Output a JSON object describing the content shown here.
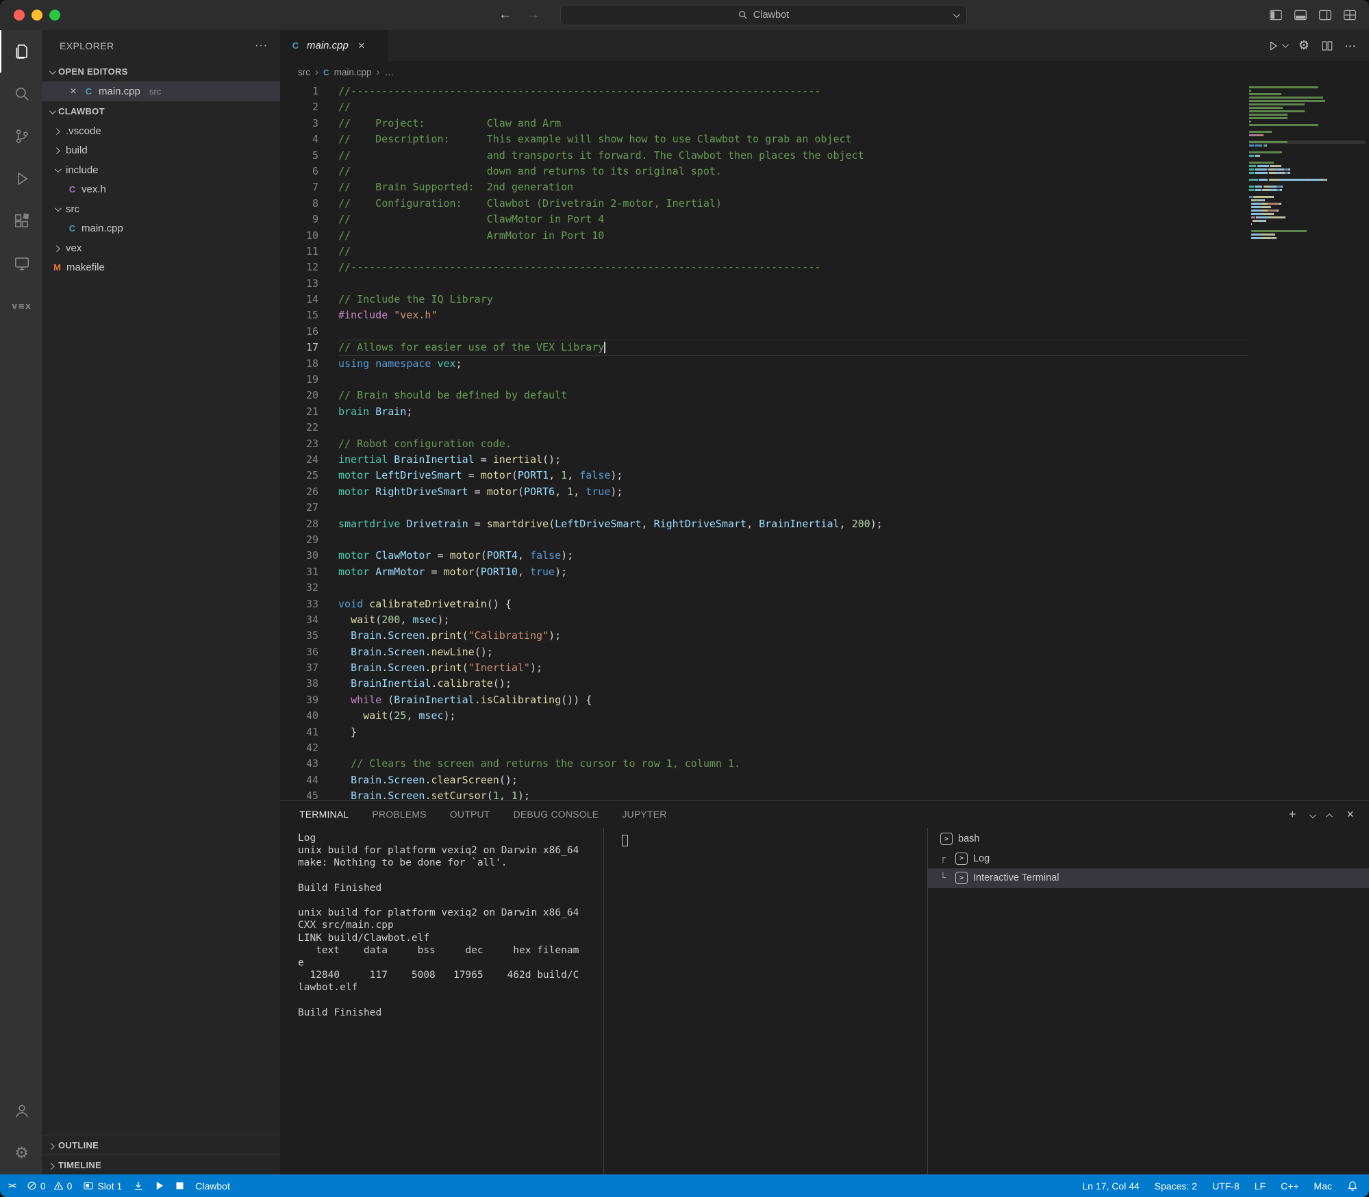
{
  "colors": {
    "accent": "#007acc",
    "titlebar-bg": "#2d2d2d",
    "activity-bg": "#333333",
    "sidebar-bg": "#252526",
    "editor-bg": "#1e1e1e",
    "selection-bg": "#37373d",
    "panel-border": "#414141",
    "tab-strip-bg": "#252526",
    "tok-comment": "#6a9955",
    "tok-keyword": "#569cd6",
    "tok-control": "#c586c0",
    "tok-type": "#4ec9b0",
    "tok-func": "#dcdcaa",
    "tok-string": "#ce9178",
    "tok-number": "#b5cea8",
    "tok-var": "#9cdcfe",
    "tok-plain": "#d4d4d4",
    "traffic-red": "#ff5f57",
    "traffic-yellow": "#febc2e",
    "traffic-green": "#28c840"
  },
  "icons": {
    "cpp": {
      "glyph": "C",
      "color": "#519aba"
    },
    "c-header": {
      "glyph": "C",
      "color": "#a074c4"
    },
    "makefile": {
      "glyph": "M",
      "color": "#e37933"
    },
    "gear": {
      "glyph": "⚙"
    },
    "more": {
      "glyph": "···"
    },
    "plus": {
      "glyph": "+"
    },
    "close": {
      "glyph": "×"
    },
    "back": {
      "glyph": "←"
    },
    "forward": {
      "glyph": "→"
    },
    "breadcrumb-sep": {
      "glyph": "›"
    },
    "remote": {
      "glyph": "><"
    },
    "vex-logo": {
      "glyph": "v≡x"
    },
    "term-prompt": {
      "glyph": ">"
    }
  },
  "titlebar": {
    "search_value": "Clawbot"
  },
  "sidebar": {
    "title": "EXPLORER",
    "open_editors": {
      "label": "OPEN EDITORS",
      "file": "main.cpp",
      "detail": "src"
    },
    "project": {
      "label": "CLAWBOT",
      "items": [
        {
          "label": ".vscode",
          "kind": "folder",
          "expanded": false,
          "indent": 1
        },
        {
          "label": "build",
          "kind": "folder",
          "expanded": false,
          "indent": 1
        },
        {
          "label": "include",
          "kind": "folder",
          "expanded": true,
          "indent": 1
        },
        {
          "label": "vex.h",
          "kind": "file",
          "icon": "c-header",
          "indent": 2
        },
        {
          "label": "src",
          "kind": "folder",
          "expanded": true,
          "indent": 1
        },
        {
          "label": "main.cpp",
          "kind": "file",
          "icon": "cpp",
          "indent": 2
        },
        {
          "label": "vex",
          "kind": "folder",
          "expanded": false,
          "indent": 1
        },
        {
          "label": "makefile",
          "kind": "file",
          "icon": "makefile",
          "indent": 1
        }
      ]
    },
    "outline_label": "OUTLINE",
    "timeline_label": "TIMELINE"
  },
  "editor": {
    "tab": {
      "label": "main.cpp"
    },
    "breadcrumb": [
      "src",
      "main.cpp",
      "…"
    ],
    "cursor": {
      "line": 17,
      "col": 44
    },
    "lines": [
      {
        "n": 1,
        "s": [
          [
            "cm",
            "//----------------------------------------------------------------------------"
          ]
        ]
      },
      {
        "n": 2,
        "s": [
          [
            "cm",
            "//"
          ]
        ]
      },
      {
        "n": 3,
        "s": [
          [
            "cm",
            "//    Project:          Claw and Arm"
          ]
        ]
      },
      {
        "n": 4,
        "s": [
          [
            "cm",
            "//    Description:      This example will show how to use Clawbot to grab an object"
          ]
        ]
      },
      {
        "n": 5,
        "s": [
          [
            "cm",
            "//                      and transports it forward. The Clawbot then places the object"
          ]
        ]
      },
      {
        "n": 6,
        "s": [
          [
            "cm",
            "//                      down and returns to its original spot."
          ]
        ]
      },
      {
        "n": 7,
        "s": [
          [
            "cm",
            "//    Brain Supported:  2nd generation"
          ]
        ]
      },
      {
        "n": 8,
        "s": [
          [
            "cm",
            "//    Configuration:    Clawbot (Drivetrain 2-motor, Inertial)"
          ]
        ]
      },
      {
        "n": 9,
        "s": [
          [
            "cm",
            "//                      ClawMotor in Port 4"
          ]
        ]
      },
      {
        "n": 10,
        "s": [
          [
            "cm",
            "//                      ArmMotor in Port 10"
          ]
        ]
      },
      {
        "n": 11,
        "s": [
          [
            "cm",
            "//"
          ]
        ]
      },
      {
        "n": 12,
        "s": [
          [
            "cm",
            "//----------------------------------------------------------------------------"
          ]
        ]
      },
      {
        "n": 13,
        "s": []
      },
      {
        "n": 14,
        "s": [
          [
            "cm",
            "// Include the IQ Library"
          ]
        ]
      },
      {
        "n": 15,
        "s": [
          [
            "ctl",
            "#include "
          ],
          [
            "st",
            "\"vex.h\""
          ]
        ]
      },
      {
        "n": 16,
        "s": []
      },
      {
        "n": 17,
        "s": [
          [
            "cm",
            "// Allows for easier use of the VEX Library"
          ]
        ]
      },
      {
        "n": 18,
        "s": [
          [
            "kw",
            "using"
          ],
          [
            "pl",
            " "
          ],
          [
            "kw",
            "namespace"
          ],
          [
            "pl",
            " "
          ],
          [
            "ty",
            "vex"
          ],
          [
            "pl",
            ";"
          ]
        ]
      },
      {
        "n": 19,
        "s": []
      },
      {
        "n": 20,
        "s": [
          [
            "cm",
            "// Brain should be defined by default"
          ]
        ]
      },
      {
        "n": 21,
        "s": [
          [
            "ty",
            "brain"
          ],
          [
            "pl",
            " "
          ],
          [
            "vr",
            "Brain"
          ],
          [
            "pl",
            ";"
          ]
        ]
      },
      {
        "n": 22,
        "s": []
      },
      {
        "n": 23,
        "s": [
          [
            "cm",
            "// Robot configuration code."
          ]
        ]
      },
      {
        "n": 24,
        "s": [
          [
            "ty",
            "inertial"
          ],
          [
            "pl",
            " "
          ],
          [
            "vr",
            "BrainInertial"
          ],
          [
            "pl",
            " = "
          ],
          [
            "fn",
            "inertial"
          ],
          [
            "pl",
            "();"
          ]
        ]
      },
      {
        "n": 25,
        "s": [
          [
            "ty",
            "motor"
          ],
          [
            "pl",
            " "
          ],
          [
            "vr",
            "LeftDriveSmart"
          ],
          [
            "pl",
            " = "
          ],
          [
            "fn",
            "motor"
          ],
          [
            "pl",
            "("
          ],
          [
            "vr",
            "PORT1"
          ],
          [
            "pl",
            ", "
          ],
          [
            "nu",
            "1"
          ],
          [
            "pl",
            ", "
          ],
          [
            "kw",
            "false"
          ],
          [
            "pl",
            ");"
          ]
        ]
      },
      {
        "n": 26,
        "s": [
          [
            "ty",
            "motor"
          ],
          [
            "pl",
            " "
          ],
          [
            "vr",
            "RightDriveSmart"
          ],
          [
            "pl",
            " = "
          ],
          [
            "fn",
            "motor"
          ],
          [
            "pl",
            "("
          ],
          [
            "vr",
            "PORT6"
          ],
          [
            "pl",
            ", "
          ],
          [
            "nu",
            "1"
          ],
          [
            "pl",
            ", "
          ],
          [
            "kw",
            "true"
          ],
          [
            "pl",
            ");"
          ]
        ]
      },
      {
        "n": 27,
        "s": []
      },
      {
        "n": 28,
        "s": [
          [
            "ty",
            "smartdrive"
          ],
          [
            "pl",
            " "
          ],
          [
            "vr",
            "Drivetrain"
          ],
          [
            "pl",
            " = "
          ],
          [
            "fn",
            "smartdrive"
          ],
          [
            "pl",
            "("
          ],
          [
            "vr",
            "LeftDriveSmart"
          ],
          [
            "pl",
            ", "
          ],
          [
            "vr",
            "RightDriveSmart"
          ],
          [
            "pl",
            ", "
          ],
          [
            "vr",
            "BrainInertial"
          ],
          [
            "pl",
            ", "
          ],
          [
            "nu",
            "200"
          ],
          [
            "pl",
            ");"
          ]
        ]
      },
      {
        "n": 29,
        "s": []
      },
      {
        "n": 30,
        "s": [
          [
            "ty",
            "motor"
          ],
          [
            "pl",
            " "
          ],
          [
            "vr",
            "ClawMotor"
          ],
          [
            "pl",
            " = "
          ],
          [
            "fn",
            "motor"
          ],
          [
            "pl",
            "("
          ],
          [
            "vr",
            "PORT4"
          ],
          [
            "pl",
            ", "
          ],
          [
            "kw",
            "false"
          ],
          [
            "pl",
            ");"
          ]
        ]
      },
      {
        "n": 31,
        "s": [
          [
            "ty",
            "motor"
          ],
          [
            "pl",
            " "
          ],
          [
            "vr",
            "ArmMotor"
          ],
          [
            "pl",
            " = "
          ],
          [
            "fn",
            "motor"
          ],
          [
            "pl",
            "("
          ],
          [
            "vr",
            "PORT10"
          ],
          [
            "pl",
            ", "
          ],
          [
            "kw",
            "true"
          ],
          [
            "pl",
            ");"
          ]
        ]
      },
      {
        "n": 32,
        "s": []
      },
      {
        "n": 33,
        "s": [
          [
            "kw",
            "void"
          ],
          [
            "pl",
            " "
          ],
          [
            "fn",
            "calibrateDrivetrain"
          ],
          [
            "pl",
            "() {"
          ]
        ]
      },
      {
        "n": 34,
        "s": [
          [
            "pl",
            "  "
          ],
          [
            "fn",
            "wait"
          ],
          [
            "pl",
            "("
          ],
          [
            "nu",
            "200"
          ],
          [
            "pl",
            ", "
          ],
          [
            "vr",
            "msec"
          ],
          [
            "pl",
            ");"
          ]
        ]
      },
      {
        "n": 35,
        "s": [
          [
            "pl",
            "  "
          ],
          [
            "vr",
            "Brain"
          ],
          [
            "pl",
            "."
          ],
          [
            "vr",
            "Screen"
          ],
          [
            "pl",
            "."
          ],
          [
            "fn",
            "print"
          ],
          [
            "pl",
            "("
          ],
          [
            "st",
            "\"Calibrating\""
          ],
          [
            "pl",
            ");"
          ]
        ]
      },
      {
        "n": 36,
        "s": [
          [
            "pl",
            "  "
          ],
          [
            "vr",
            "Brain"
          ],
          [
            "pl",
            "."
          ],
          [
            "vr",
            "Screen"
          ],
          [
            "pl",
            "."
          ],
          [
            "fn",
            "newLine"
          ],
          [
            "pl",
            "();"
          ]
        ]
      },
      {
        "n": 37,
        "s": [
          [
            "pl",
            "  "
          ],
          [
            "vr",
            "Brain"
          ],
          [
            "pl",
            "."
          ],
          [
            "vr",
            "Screen"
          ],
          [
            "pl",
            "."
          ],
          [
            "fn",
            "print"
          ],
          [
            "pl",
            "("
          ],
          [
            "st",
            "\"Inertial\""
          ],
          [
            "pl",
            ");"
          ]
        ]
      },
      {
        "n": 38,
        "s": [
          [
            "pl",
            "  "
          ],
          [
            "vr",
            "BrainInertial"
          ],
          [
            "pl",
            "."
          ],
          [
            "fn",
            "calibrate"
          ],
          [
            "pl",
            "();"
          ]
        ]
      },
      {
        "n": 39,
        "s": [
          [
            "pl",
            "  "
          ],
          [
            "ctl",
            "while"
          ],
          [
            "pl",
            " ("
          ],
          [
            "vr",
            "BrainInertial"
          ],
          [
            "pl",
            "."
          ],
          [
            "fn",
            "isCalibrating"
          ],
          [
            "pl",
            "()) {"
          ]
        ]
      },
      {
        "n": 40,
        "s": [
          [
            "pl",
            "    "
          ],
          [
            "fn",
            "wait"
          ],
          [
            "pl",
            "("
          ],
          [
            "nu",
            "25"
          ],
          [
            "pl",
            ", "
          ],
          [
            "vr",
            "msec"
          ],
          [
            "pl",
            ");"
          ]
        ]
      },
      {
        "n": 41,
        "s": [
          [
            "pl",
            "  }"
          ]
        ]
      },
      {
        "n": 42,
        "s": []
      },
      {
        "n": 43,
        "s": [
          [
            "pl",
            "  "
          ],
          [
            "cm",
            "// Clears the screen and returns the cursor to row 1, column 1."
          ]
        ]
      },
      {
        "n": 44,
        "s": [
          [
            "pl",
            "  "
          ],
          [
            "vr",
            "Brain"
          ],
          [
            "pl",
            "."
          ],
          [
            "vr",
            "Screen"
          ],
          [
            "pl",
            "."
          ],
          [
            "fn",
            "clearScreen"
          ],
          [
            "pl",
            "();"
          ]
        ]
      },
      {
        "n": 45,
        "s": [
          [
            "pl",
            "  "
          ],
          [
            "vr",
            "Brain"
          ],
          [
            "pl",
            "."
          ],
          [
            "vr",
            "Screen"
          ],
          [
            "pl",
            "."
          ],
          [
            "fn",
            "setCursor"
          ],
          [
            "pl",
            "("
          ],
          [
            "nu",
            "1"
          ],
          [
            "pl",
            ", "
          ],
          [
            "nu",
            "1"
          ],
          [
            "pl",
            ");"
          ]
        ]
      }
    ]
  },
  "panel": {
    "tabs": [
      "TERMINAL",
      "PROBLEMS",
      "OUTPUT",
      "DEBUG CONSOLE",
      "JUPYTER"
    ],
    "active_tab": "TERMINAL",
    "terminal_output": [
      "Log",
      "unix build for platform vexiq2 on Darwin x86_64",
      "make: Nothing to be done for `all'.",
      "",
      "Build Finished",
      "",
      "unix build for platform vexiq2 on Darwin x86_64",
      "CXX src/main.cpp",
      "LINK build/Clawbot.elf",
      "   text    data     bss     dec     hex filenam",
      "e",
      "  12840     117    5008   17965    462d build/C",
      "lawbot.elf",
      "",
      "Build Finished"
    ],
    "terminals": [
      {
        "label": "bash",
        "connector": ""
      },
      {
        "label": "Log",
        "connector": "┌"
      },
      {
        "label": "Interactive Terminal",
        "connector": "└",
        "selected": true
      }
    ]
  },
  "status_bar": {
    "errors": "0",
    "warnings": "0",
    "slot": "Slot 1",
    "project": "Clawbot",
    "line_col": "Ln 17, Col 44",
    "indent": "Spaces: 2",
    "encoding": "UTF-8",
    "eol": "LF",
    "language": "C++",
    "os": "Mac"
  }
}
